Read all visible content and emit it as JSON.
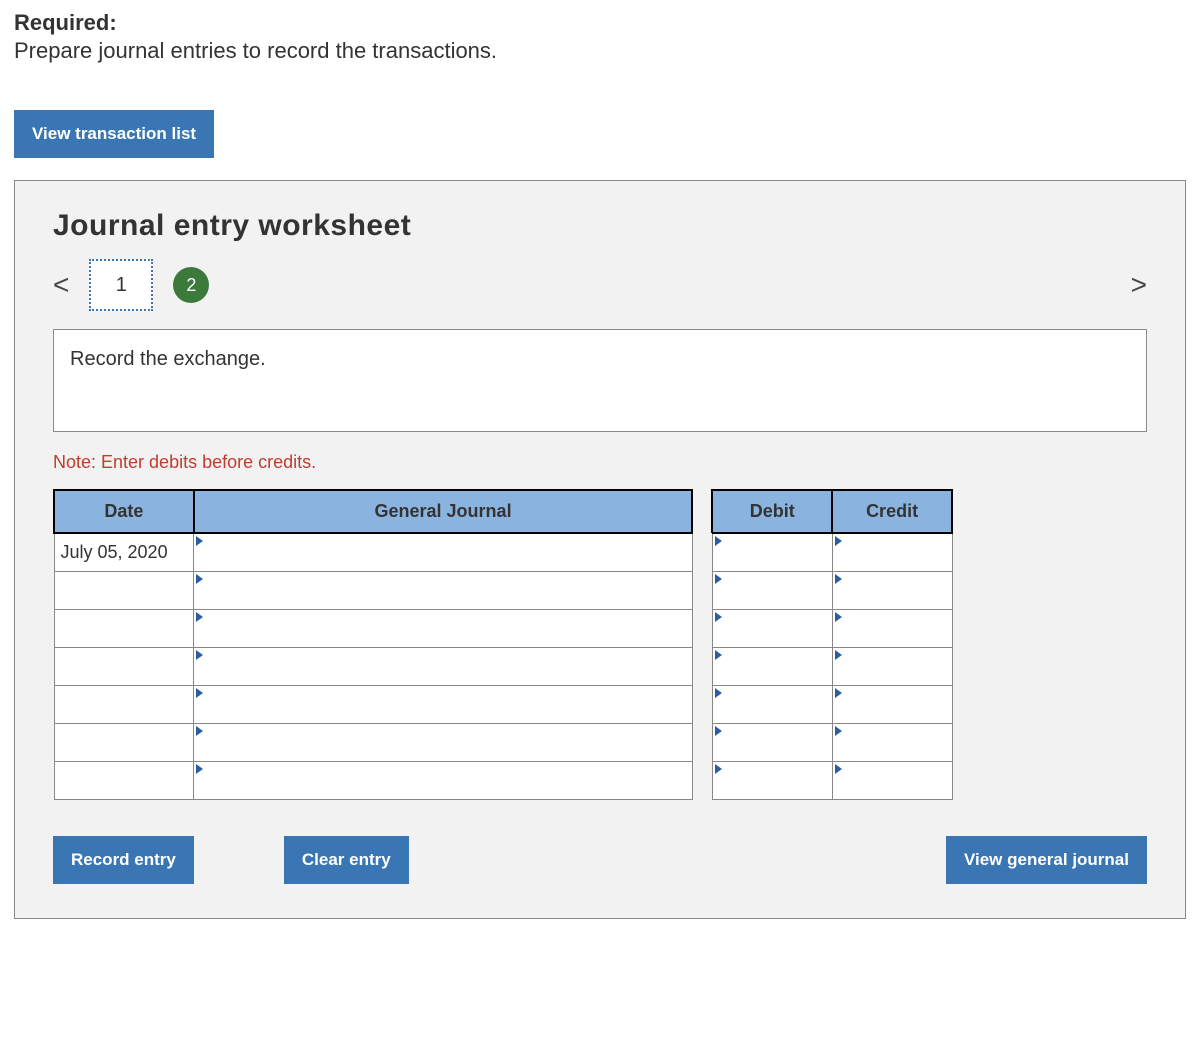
{
  "header": {
    "required_label": "Required:",
    "required_text": "Prepare journal entries to record the transactions."
  },
  "buttons": {
    "view_transaction_list": "View transaction list",
    "record_entry": "Record entry",
    "clear_entry": "Clear entry",
    "view_general_journal": "View general journal"
  },
  "panel": {
    "title": "Journal entry worksheet",
    "steps": [
      "1",
      "2"
    ],
    "chev_left": "<",
    "chev_right": ">",
    "instruction": "Record the exchange.",
    "note": "Note: Enter debits before credits."
  },
  "table": {
    "headers": {
      "date": "Date",
      "general_journal": "General Journal",
      "debit": "Debit",
      "credit": "Credit"
    },
    "rows": [
      {
        "date": "July 05, 2020",
        "general_journal": "",
        "debit": "",
        "credit": ""
      },
      {
        "date": "",
        "general_journal": "",
        "debit": "",
        "credit": ""
      },
      {
        "date": "",
        "general_journal": "",
        "debit": "",
        "credit": ""
      },
      {
        "date": "",
        "general_journal": "",
        "debit": "",
        "credit": ""
      },
      {
        "date": "",
        "general_journal": "",
        "debit": "",
        "credit": ""
      },
      {
        "date": "",
        "general_journal": "",
        "debit": "",
        "credit": ""
      },
      {
        "date": "",
        "general_journal": "",
        "debit": "",
        "credit": ""
      }
    ]
  }
}
